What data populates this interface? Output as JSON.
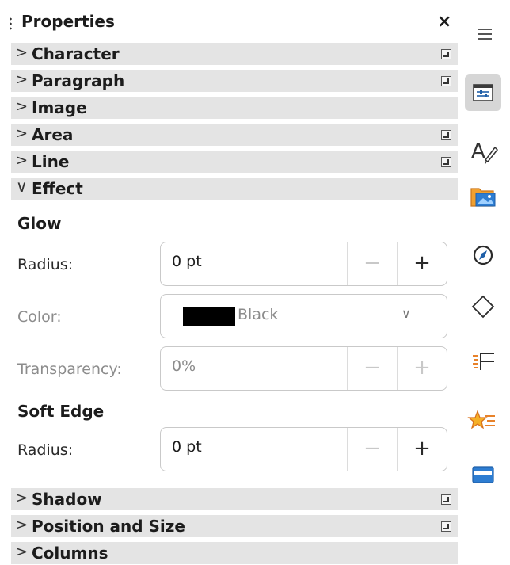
{
  "panel": {
    "title": "Properties",
    "close_symbol": "×"
  },
  "sections_top": [
    {
      "label": "Character",
      "chevron": ">"
    },
    {
      "label": "Paragraph",
      "chevron": ">"
    },
    {
      "label": "Image",
      "chevron": ">"
    },
    {
      "label": "Area",
      "chevron": ">"
    },
    {
      "label": "Line",
      "chevron": ">"
    },
    {
      "label": "Effect",
      "chevron": "∨"
    }
  ],
  "effect": {
    "glow_heading": "Glow",
    "radius_label": "Radius:",
    "radius_value": "0 pt",
    "color_label": "Color:",
    "color_value": "Black",
    "color_swatch": "#000000",
    "transparency_label": "Transparency:",
    "transparency_value": "0%",
    "soft_edge_heading": "Soft Edge",
    "soft_radius_label": "Radius:",
    "soft_radius_value": "0 pt",
    "minus": "−",
    "plus": "+",
    "dropdown_arrow": "∨"
  },
  "sections_bottom": [
    {
      "label": "Shadow",
      "chevron": ">"
    },
    {
      "label": "Position and Size",
      "chevron": ">"
    },
    {
      "label": "Columns",
      "chevron": ">"
    }
  ],
  "sidebar_icons": [
    "menu-icon",
    "properties-icon",
    "styles-icon",
    "gallery-icon",
    "navigator-icon",
    "shapes-icon",
    "page-icon",
    "style-inspector-icon",
    "manage-changes-icon"
  ],
  "colors": {
    "section_bg": "#e4e4e4",
    "active_tab_bg": "#d6d6d6",
    "accent_blue": "#1f5fa8",
    "orange": "#e8822a"
  }
}
